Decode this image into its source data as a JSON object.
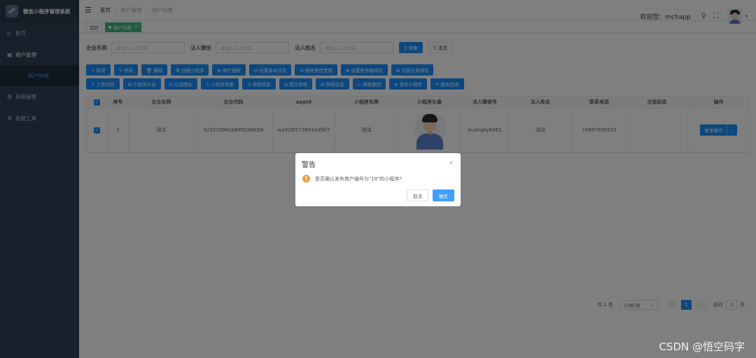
{
  "sidebar": {
    "logo_glyph": "☍",
    "title": "微信小程序管理系统",
    "items": [
      {
        "icon": "⌂",
        "label": "首页"
      },
      {
        "icon": "▣",
        "label": "商户管理"
      },
      {
        "icon": "⚙",
        "label": "系统管理"
      },
      {
        "icon": "⚒",
        "label": "系统工具"
      }
    ],
    "sub_item": "商户列表",
    "arrow": "⌄"
  },
  "header": {
    "hamburger": "☰",
    "breadcrumbs": [
      "首页",
      "商户管理",
      "商户列表"
    ],
    "sep": "/",
    "welcome": "欢迎您：mchapp",
    "search_glyph": "⚲",
    "fullscreen_glyph": "⛶",
    "caret": "▾"
  },
  "tags": {
    "home": "首页",
    "active": "商户列表",
    "close": "×"
  },
  "search": {
    "company_label": "企业名称",
    "company_placeholder": "请输入企业名称",
    "wechat_label": "法人微信",
    "wechat_placeholder": "请输入法人微信",
    "name_label": "法人姓名",
    "name_placeholder": "请输入法人姓名",
    "search_btn": "⚲ 搜索",
    "reset_btn": "↻ 重置"
  },
  "toolbar_row1": [
    "+ 新增",
    "✎ 修改",
    "🗑 删除",
    "✪ 创建小程序",
    "⊕ 商户授权",
    "⊟ 设置基本信息",
    "⊡ 服务类目管理",
    "⊞ 设置服务器域名",
    "⊞ 设置业务域名"
  ],
  "toolbar_row2": [
    "⇪ 上传代码",
    "⊞ 小程序认证",
    "⊡ 认证图标",
    "⇩ 小程序审查",
    "⊙ 审核状态",
    "⊟ 提交审核",
    "⊛ 审核状态",
    "← 审核撤回",
    "➤ 发布小程序",
    "↶ 版本回退"
  ],
  "table": {
    "headers": [
      "",
      "序号",
      "企业名称",
      "企业代码",
      "appid",
      "小程序名称",
      "小程序头像",
      "法人微信号",
      "法人姓名",
      "联系电话",
      "注册状态",
      "操作"
    ],
    "row": {
      "checked": "✓",
      "index": "1",
      "company": "测试",
      "code": "92321QMA34M5026KQ4",
      "appid": "wx926f573941e4fbf7",
      "app_name": "测试",
      "wechat": "huangby6261",
      "legal_name": "测试",
      "phone": "18987895523",
      "status": "",
      "action": "更多操作",
      "action_caret": "⌄"
    }
  },
  "pagination": {
    "total": "共 1 条",
    "page_size": "10条/页",
    "prev": "‹",
    "current": "1",
    "next": "›",
    "goto_label": "前往",
    "goto_value": "1",
    "page_unit": "页"
  },
  "dialog": {
    "title": "警告",
    "close": "×",
    "warn_glyph": "!",
    "message": "是否确认发布商户编号为\"18\"的小程序?",
    "cancel": "取消",
    "confirm": "确定"
  },
  "watermark": "CSDN @悟空码字"
}
